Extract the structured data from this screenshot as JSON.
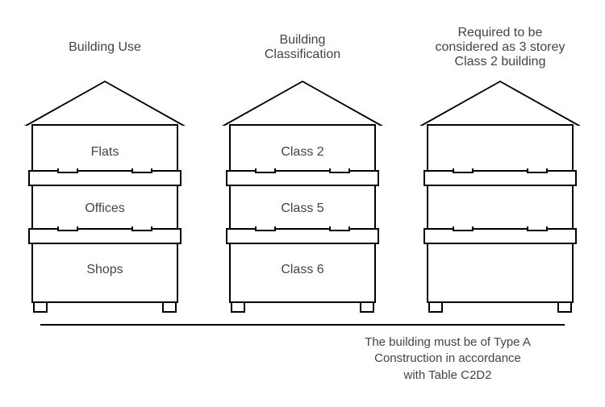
{
  "columns": [
    {
      "header": [
        "Building Use"
      ],
      "floors": [
        "Flats",
        "Offices",
        "Shops"
      ]
    },
    {
      "header": [
        "Building",
        "Classification"
      ],
      "floors": [
        "Class 2",
        "Class 5",
        "Class 6"
      ]
    },
    {
      "header": [
        "Required to be",
        "considered as 3 storey",
        "Class 2 building"
      ],
      "floors": [
        "",
        "",
        ""
      ]
    }
  ],
  "footnote": [
    "The building must be of Type A",
    "Construction in accordance",
    "with Table C2D2"
  ]
}
